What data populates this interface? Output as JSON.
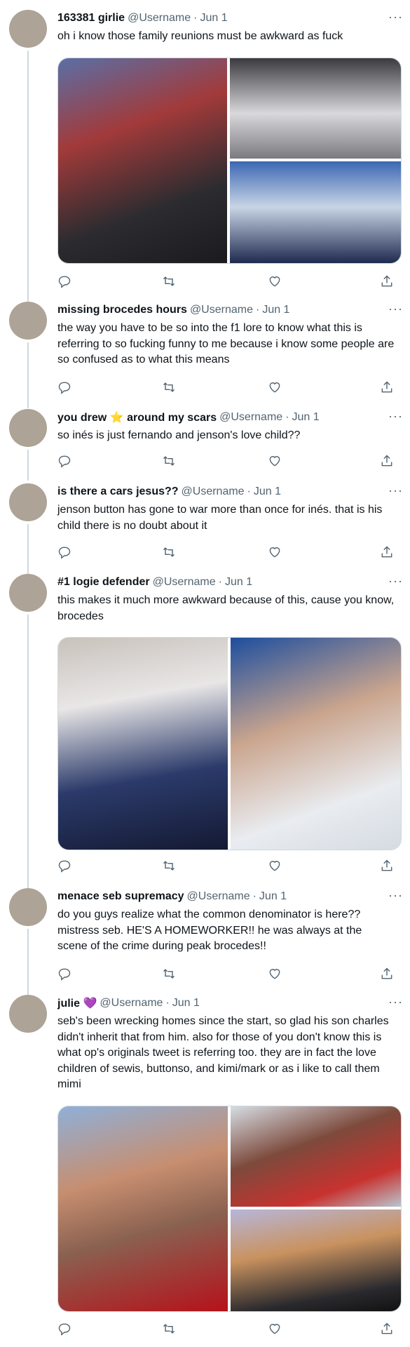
{
  "tweets": [
    {
      "name": "163381 girlie",
      "handle": "@Username",
      "date": "Jun 1",
      "text": "oh i know those family reunions must be awkward as fuck"
    },
    {
      "name": "missing brocedes hours",
      "handle": "@Username",
      "date": "Jun 1",
      "text": "the way you have to be so into the f1 lore to know what this is referring to so fucking funny to me because i know some people are so confused as to what this means"
    },
    {
      "name_before": "you drew",
      "name_emoji": "⭐",
      "name_after": "around my scars",
      "handle": "@Username",
      "date": "Jun 1",
      "text": "so inés is just fernando and jenson's love child??"
    },
    {
      "name": "is there a cars jesus??",
      "handle": "@Username",
      "date": "Jun 1",
      "text": "jenson button has gone to war more than once for inés. that is his child there is no doubt about it"
    },
    {
      "name": "#1 logie defender",
      "handle": "@Username",
      "date": "Jun 1",
      "text": "this makes it much more awkward because of this, cause you know, brocedes"
    },
    {
      "name": "menace seb supremacy",
      "handle": "@Username",
      "date": "Jun 1",
      "text": "do you guys realize what the common denominator is here?? mistress seb. HE'S A HOMEWORKER!! he was always at the scene of the crime during peak brocedes!!"
    },
    {
      "name": "julie",
      "name_emoji": "💜",
      "handle": "@Username",
      "date": "Jun 1",
      "text": "seb's been wrecking homes since the start, so glad his son charles didn't inherit that from him. also for those of you don't know this is what op's originals tweet is referring too. they are in fact the love children of sewis, buttonso, and kimi/mark or as i like to call them mimi"
    }
  ],
  "separator": "·",
  "more_label": "···",
  "icons": [
    "reply-icon",
    "retweet-icon",
    "like-icon",
    "share-icon"
  ],
  "colors": {
    "secondary_text": "#536471",
    "thread_line": "#cfd9de",
    "avatar": "#ada396"
  }
}
